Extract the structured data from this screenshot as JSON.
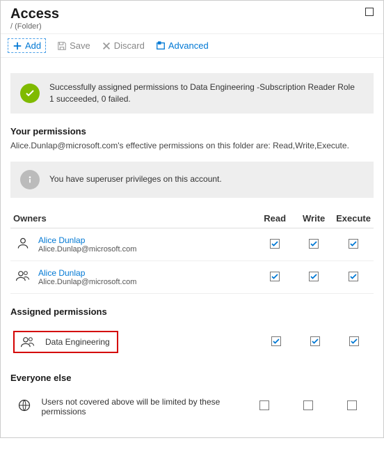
{
  "header": {
    "title": "Access",
    "path": "(Folder)"
  },
  "toolbar": {
    "add": "Add",
    "save": "Save",
    "discard": "Discard",
    "advanced": "Advanced"
  },
  "success": {
    "line1": "Successfully assigned permissions to Data Engineering -Subscription Reader Role",
    "line2": "1 succeeded, 0 failed."
  },
  "yourperm": {
    "title": "Your permissions",
    "sub": "Alice.Dunlap@microsoft.com's effective permissions on this folder are: Read,Write,Execute.",
    "info": "You have superuser privileges on this account."
  },
  "cols": {
    "owners": "Owners",
    "read": "Read",
    "write": "Write",
    "execute": "Execute"
  },
  "owners": [
    {
      "name": "Alice Dunlap",
      "email": "Alice.Dunlap@microsoft.com",
      "read": true,
      "write": true,
      "execute": true,
      "kind": "user"
    },
    {
      "name": "Alice Dunlap",
      "email": "Alice.Dunlap@microsoft.com",
      "read": true,
      "write": true,
      "execute": true,
      "kind": "users"
    }
  ],
  "assigned": {
    "title": "Assigned permissions",
    "items": [
      {
        "name": "Data Engineering",
        "read": true,
        "write": true,
        "execute": true
      }
    ]
  },
  "everyone": {
    "title": "Everyone else",
    "desc": "Users not covered above will be limited by these permissions",
    "read": false,
    "write": false,
    "execute": false
  }
}
